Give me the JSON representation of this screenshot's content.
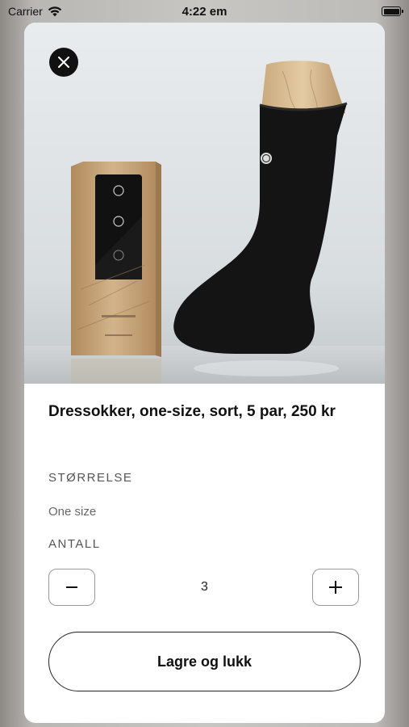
{
  "status_bar": {
    "carrier": "Carrier",
    "time": "4:22 em",
    "battery_level": 1.0
  },
  "product": {
    "image_alt": "Black dress sock on wooden foot form next to a kraft paper box of five pairs",
    "title": "Dressokker, one-size, sort, 5 par, 250 kr",
    "size_label": "STØRRELSE",
    "size_value": "One size",
    "quantity_label": "ANTALL",
    "quantity": "3",
    "decrement_label": "−",
    "increment_label": "+"
  },
  "actions": {
    "save_close_label": "Lagre og lukk"
  },
  "icons": {
    "close": "close-icon",
    "wifi": "wifi-icon",
    "battery": "battery-icon"
  },
  "colors": {
    "accent": "#111111",
    "border": "#999999"
  }
}
